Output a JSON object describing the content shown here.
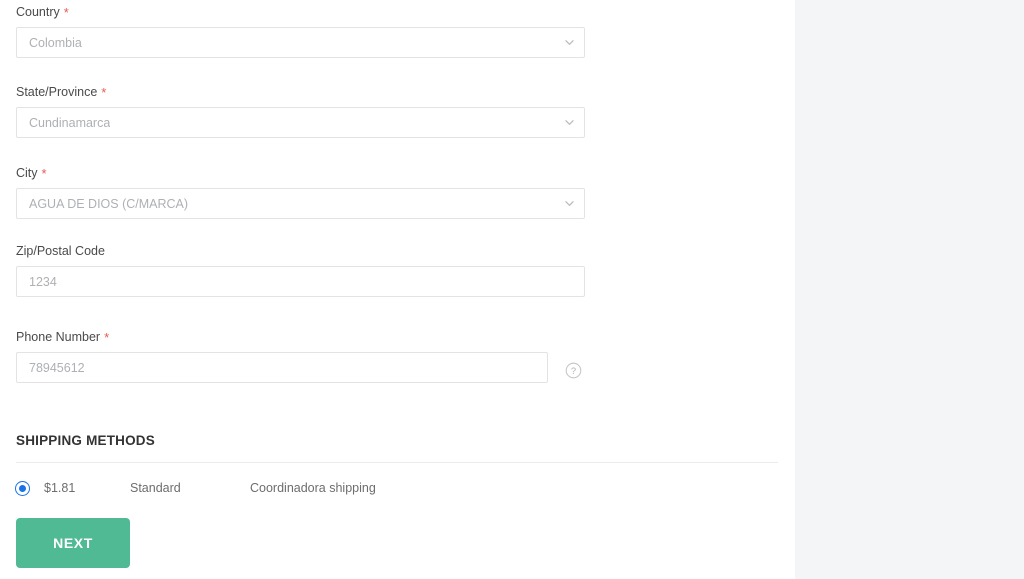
{
  "colors": {
    "required_star": "#e8594f",
    "radio_selected": "#1a73e8",
    "next_button": "#4fba94",
    "side_rail": "#f4f5f7",
    "field_border": "#e3e3e3",
    "placeholder_text": "#aeb0b5",
    "label_text": "#4a4a4a"
  },
  "form": {
    "fields": [
      {
        "label": "Country",
        "required": true,
        "required_marker": "*",
        "type": "select",
        "value": "Colombia",
        "icon": "chevron-down-icon"
      },
      {
        "label": "State/Province",
        "required": true,
        "required_marker": "*",
        "type": "select",
        "value": "Cundinamarca",
        "icon": "chevron-down-icon"
      },
      {
        "label": "City",
        "required": true,
        "required_marker": "*",
        "type": "select",
        "value": "AGUA DE DIOS (C/MARCA)",
        "icon": "chevron-down-icon"
      },
      {
        "label": "Zip/Postal Code",
        "required": false,
        "required_marker": "",
        "type": "text",
        "value": "1234",
        "icon": ""
      },
      {
        "label": "Phone Number",
        "required": true,
        "required_marker": "*",
        "type": "text",
        "value": "78945612",
        "icon": "help-circle-icon"
      }
    ]
  },
  "shipping": {
    "heading": "SHIPPING METHODS",
    "methods": [
      {
        "selected": true,
        "price": "$1.81",
        "name": "Standard",
        "carrier": "Coordinadora shipping"
      }
    ]
  },
  "actions": {
    "next_label": "NEXT"
  }
}
